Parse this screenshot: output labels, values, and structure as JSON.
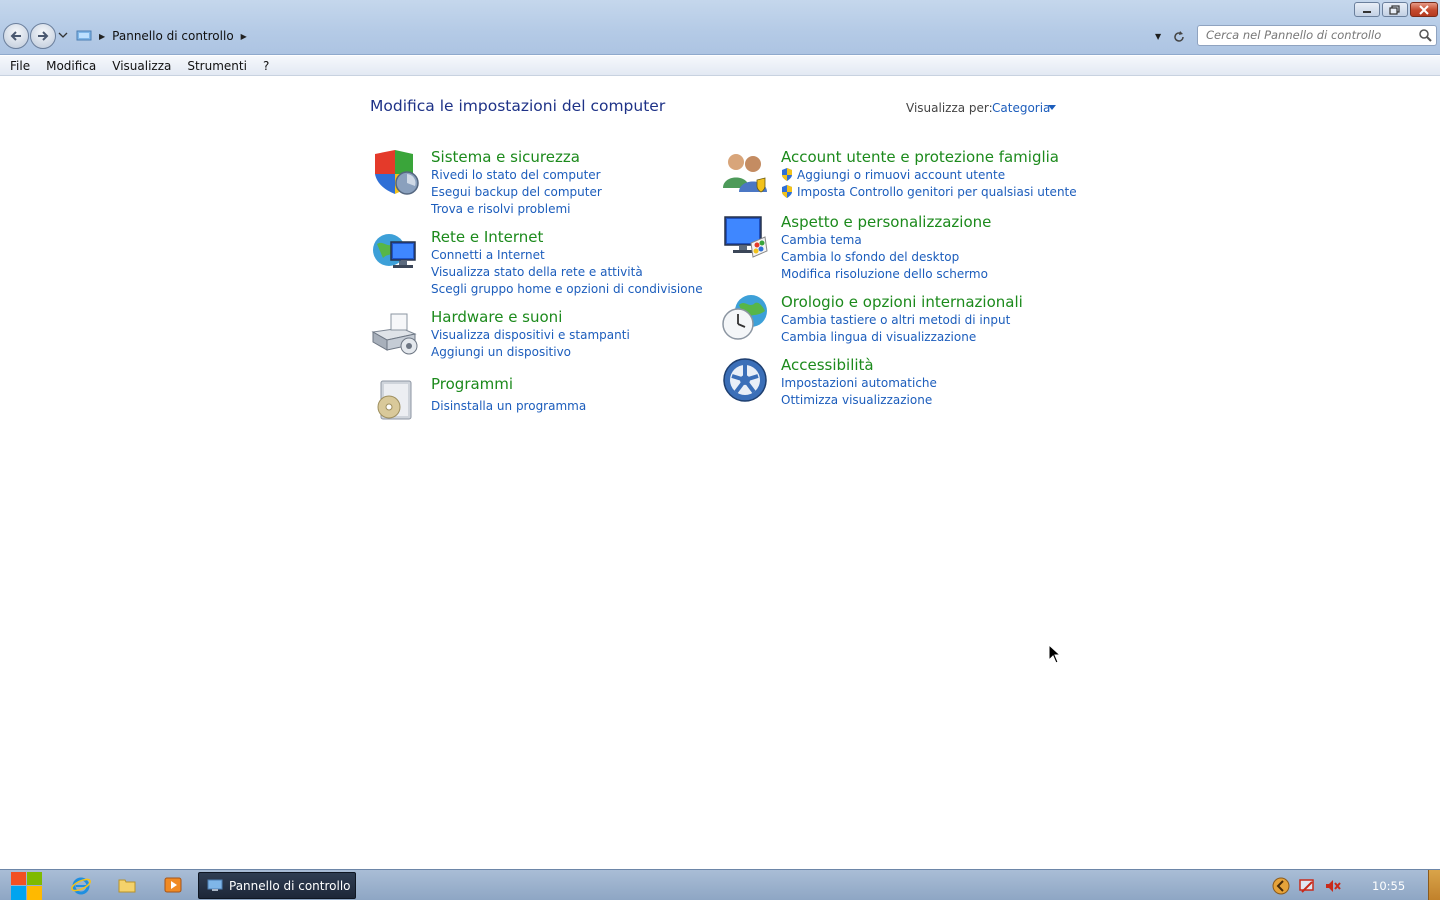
{
  "window": {
    "breadcrumb": [
      "Pannello di controllo"
    ],
    "search_placeholder": "Cerca nel Pannello di controllo"
  },
  "menubar": [
    "File",
    "Modifica",
    "Visualizza",
    "Strumenti",
    "?"
  ],
  "content": {
    "title": "Modifica le impostazioni del computer",
    "viewby_label": "Visualizza per:",
    "viewby_value": "Categoria",
    "categories": [
      {
        "title": "Sistema e sicurezza",
        "icon": "system-security-icon",
        "links": [
          "Rivedi lo stato del computer",
          "Esegui backup del computer",
          "Trova e risolvi problemi"
        ]
      },
      {
        "title": "Rete e Internet",
        "icon": "network-internet-icon",
        "links": [
          "Connetti a Internet",
          "Visualizza stato della rete e attività",
          "Scegli gruppo home e opzioni di condivisione"
        ]
      },
      {
        "title": "Hardware e suoni",
        "icon": "hardware-sound-icon",
        "links": [
          "Visualizza dispositivi e stampanti",
          "Aggiungi un dispositivo"
        ]
      },
      {
        "title": "Programmi",
        "icon": "programs-icon",
        "links": [
          "Disinstalla un programma"
        ]
      },
      {
        "title": "Account utente e protezione famiglia",
        "icon": "user-accounts-icon",
        "links": [
          "Aggiungi o rimuovi account utente",
          "Imposta Controllo genitori per qualsiasi utente"
        ]
      },
      {
        "title": "Aspetto e personalizzazione",
        "icon": "appearance-icon",
        "links": [
          "Cambia tema",
          "Cambia lo sfondo del desktop",
          "Modifica risoluzione dello schermo"
        ]
      },
      {
        "title": "Orologio e opzioni internazionali",
        "icon": "clock-region-icon",
        "links": [
          "Cambia tastiere o altri metodi di input",
          "Cambia lingua di visualizzazione"
        ]
      },
      {
        "title": "Accessibilità",
        "icon": "accessibility-icon",
        "links": [
          "Impostazioni automatiche",
          "Ottimizza visualizzazione"
        ]
      }
    ]
  },
  "taskbar": {
    "task_label": "Pannello di controllo",
    "clock": "10:55"
  },
  "colors": {
    "link": "#1c5dbc",
    "category_title": "#1c8a1c",
    "page_title": "#1e3287"
  }
}
